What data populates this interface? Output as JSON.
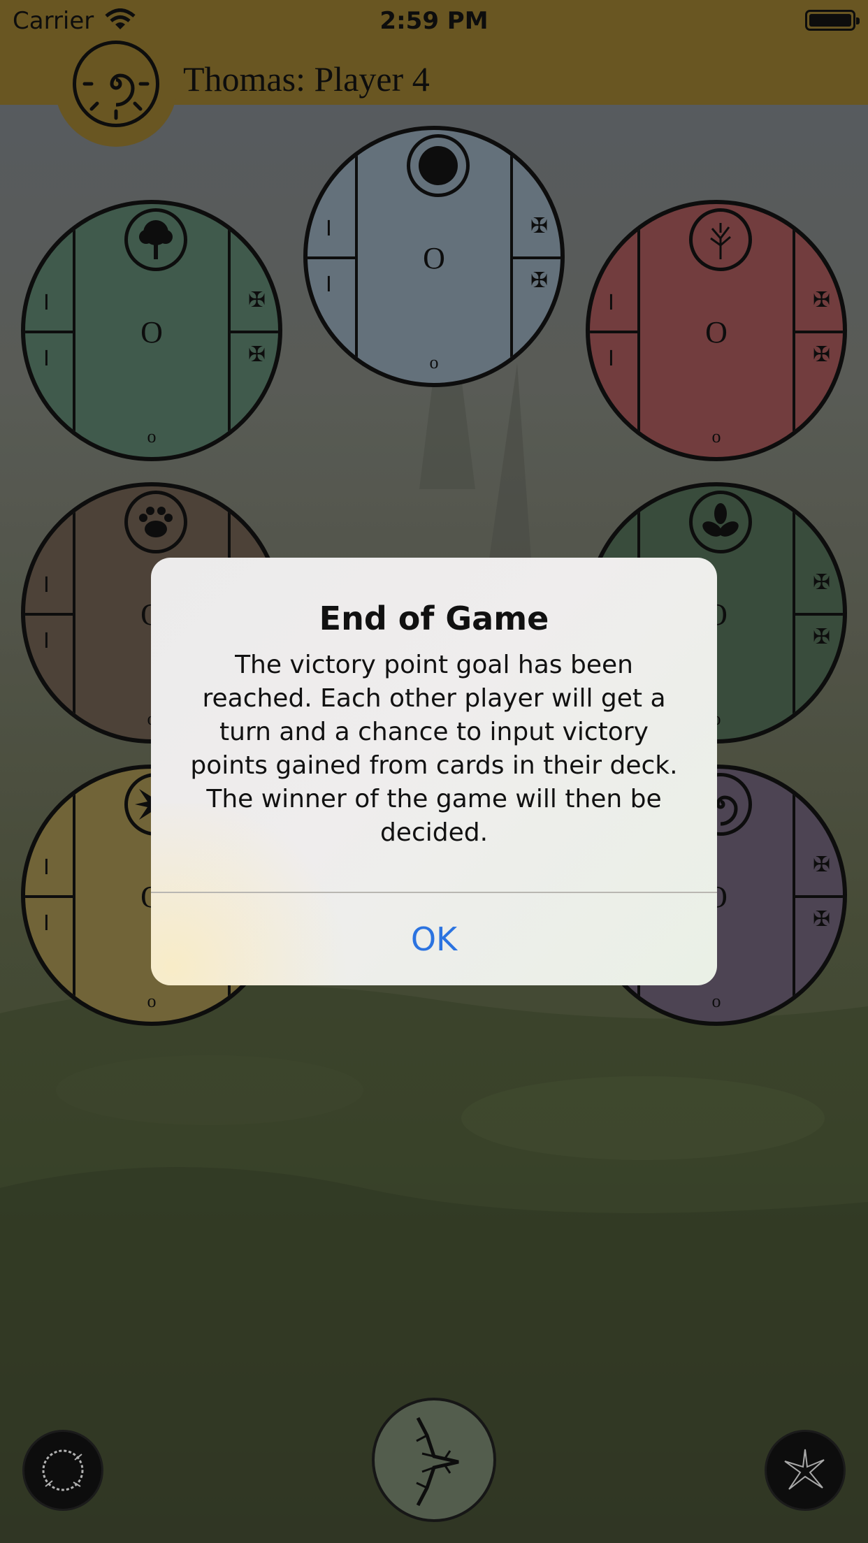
{
  "status_bar": {
    "carrier": "Carrier",
    "time": "2:59 PM"
  },
  "header": {
    "title": "Thomas: Player 4",
    "accent_color": "#80692a",
    "avatar_icon": "sun-spiral-icon"
  },
  "dials": [
    {
      "id": "green-tree",
      "color": "#4f6e5d",
      "emblem": "tree-icon",
      "center_value": "O",
      "bottom_value": "o",
      "left_glyph": "I",
      "right_glyph": "✠"
    },
    {
      "id": "blue-moon",
      "color": "#7a8a96",
      "emblem": "moon-icon",
      "center_value": "O",
      "bottom_value": "o",
      "left_glyph": "I",
      "right_glyph": "✠"
    },
    {
      "id": "red-branch",
      "color": "#8b4b4c",
      "emblem": "bare-tree-icon",
      "center_value": "O",
      "bottom_value": "o",
      "left_glyph": "I",
      "right_glyph": "✠"
    },
    {
      "id": "brown-paw",
      "color": "#5e5145",
      "emblem": "paw-icon",
      "center_value": "O",
      "bottom_value": "o",
      "left_glyph": "I",
      "right_glyph": "✠"
    },
    {
      "id": "green-leaf",
      "color": "#465d4a",
      "emblem": "triquetra-icon",
      "center_value": "O",
      "bottom_value": "o",
      "left_glyph": "I",
      "right_glyph": "✠"
    },
    {
      "id": "yellow-sun",
      "color": "#8a7b45",
      "emblem": "starburst-icon",
      "center_value": "O",
      "bottom_value": "o",
      "left_glyph": "I",
      "right_glyph": "✠"
    },
    {
      "id": "purple-spiral",
      "color": "#5e5366",
      "emblem": "spiral-icon",
      "center_value": "O",
      "bottom_value": "o",
      "left_glyph": "I",
      "right_glyph": "✠"
    }
  ],
  "bottom_controls": {
    "left_icon": "thorn-ring-icon",
    "center_icon": "branch-arrow-icon",
    "right_icon": "cracked-star-icon"
  },
  "alert": {
    "title": "End of Game",
    "message": "The victory point goal has been reached. Each other player will get a turn and a chance to input victory points gained from cards in their deck. The winner of the game will then be decided.",
    "ok_label": "OK",
    "ok_color": "#2b73e0"
  }
}
